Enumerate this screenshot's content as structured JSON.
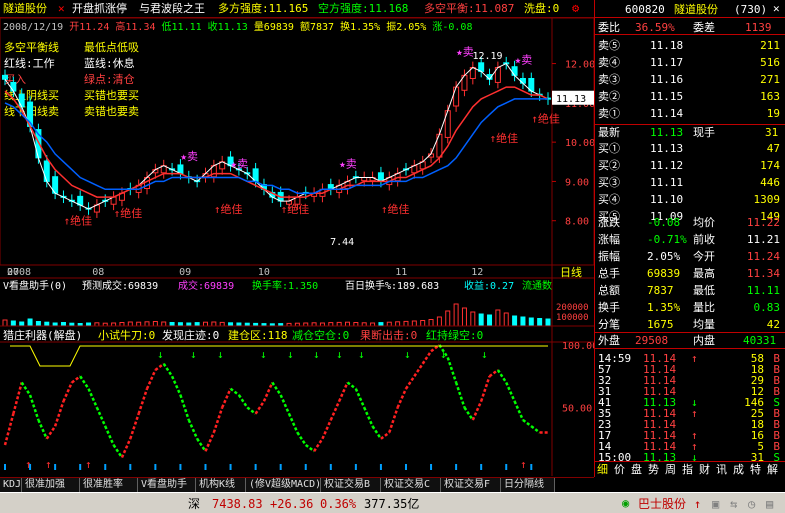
{
  "header": {
    "stock": "隧道股份",
    "items": [
      {
        "label": "开盘抓涨停",
        "color": "#ffffff"
      },
      {
        "label": "与君波段之王",
        "color": "#ffffff"
      },
      {
        "label": "多方强度:11.165",
        "color": "#ffff00"
      },
      {
        "label": "空方强度:11.168",
        "color": "#00ff00"
      },
      {
        "label": "多空平衡:11.087",
        "color": "#ff4040"
      },
      {
        "label": "洗盘:0",
        "color": "#ffff00"
      }
    ]
  },
  "ohlc_bar": {
    "date": "2008/12/19",
    "open": "开11.24",
    "high": "高11.34",
    "low": "低11.11",
    "close": "收11.13",
    "volume": "量69839",
    "amount": "额7837",
    "turnover": "换1.35%",
    "amplitude": "振2.05%",
    "change": "涨-0.08"
  },
  "legend": {
    "rows": [
      {
        "a": "多空平衡线",
        "b": "最低点低吸"
      },
      {
        "a": "红线:工作",
        "b": "蓝线:休息"
      },
      {
        "a": "买入",
        "b": "绿点:清仓"
      },
      {
        "a": "线上阴线买",
        "b": "买错也要买"
      },
      {
        "a": "线下阳线卖",
        "b": "卖错也要卖"
      }
    ]
  },
  "chart_annotations": {
    "sell_label": "卖",
    "buy_label": "绝佳",
    "high_price": "12.19",
    "low_price": "7.44",
    "current_price": "11.13",
    "timeframe": "日线"
  },
  "chart_data": [
    {
      "type": "line",
      "title": "",
      "x_axis_labels": [
        "2008",
        "07",
        "08",
        "09",
        "10",
        "11",
        "12"
      ],
      "ylim": [
        7,
        12.6
      ],
      "y_ticks": [
        12.0,
        11.0,
        10.0,
        9.0,
        8.0
      ],
      "series": [
        {
          "values": [
            11.6,
            11.3,
            10.9,
            10.4,
            9.6,
            9.0,
            8.7,
            8.6,
            8.5,
            8.4,
            8.3,
            8.4,
            8.5,
            8.6,
            8.7,
            8.8,
            8.9,
            9.1,
            9.3,
            9.4,
            9.3,
            9.2,
            9.1,
            9.0,
            9.2,
            9.4,
            9.5,
            9.4,
            9.3,
            9.2,
            9.0,
            8.8,
            8.6,
            8.5,
            8.5,
            8.6,
            8.7,
            8.7,
            8.8,
            8.8,
            8.9,
            9.0,
            9.1,
            9.1,
            9.1,
            9.0,
            9.1,
            9.2,
            9.3,
            9.4,
            9.5,
            9.7,
            10.2,
            10.8,
            11.4,
            11.7,
            11.9,
            11.8,
            11.6,
            11.9,
            12.0,
            11.7,
            11.5,
            11.3,
            11.2,
            11.1
          ]
        },
        {
          "values": [
            11.3,
            11.1,
            10.8,
            10.4,
            10.0,
            9.6,
            9.3,
            9.1,
            8.9,
            8.8,
            8.7,
            8.6,
            8.6,
            8.6,
            8.7,
            8.8,
            8.9,
            9.0,
            9.1,
            9.2,
            9.2,
            9.2,
            9.1,
            9.1,
            9.1,
            9.2,
            9.2,
            9.2,
            9.1,
            9.0,
            8.9,
            8.8,
            8.7,
            8.6,
            8.6,
            8.6,
            8.6,
            8.7,
            8.7,
            8.8,
            8.8,
            8.9,
            8.9,
            9.0,
            9.0,
            9.0,
            9.0,
            9.1,
            9.1,
            9.2,
            9.3,
            9.4,
            9.6,
            9.9,
            10.3,
            10.6,
            10.9,
            11.1,
            11.2,
            11.3,
            11.4,
            11.4,
            11.3,
            11.2,
            11.2,
            11.1
          ]
        },
        {
          "values": [
            11.0,
            10.9,
            10.7,
            10.5,
            10.2,
            10.0,
            9.7,
            9.5,
            9.3,
            9.1,
            9.0,
            8.9,
            8.8,
            8.8,
            8.8,
            8.8,
            8.8,
            8.9,
            9.0,
            9.0,
            9.1,
            9.1,
            9.1,
            9.1,
            9.1,
            9.1,
            9.1,
            9.1,
            9.1,
            9.0,
            9.0,
            8.9,
            8.9,
            8.8,
            8.8,
            8.7,
            8.7,
            8.7,
            8.8,
            8.8,
            8.8,
            8.8,
            8.9,
            8.9,
            8.9,
            8.9,
            9.0,
            9.0,
            9.0,
            9.1,
            9.1,
            9.2,
            9.3,
            9.4,
            9.6,
            9.9,
            10.2,
            10.5,
            10.7,
            10.9,
            11.0,
            11.1,
            11.1,
            11.1,
            11.1,
            11.1
          ]
        }
      ]
    },
    {
      "type": "bar",
      "title": "V看盘助手(0)",
      "text": "预测成交:69839",
      "ylim": [
        0,
        300000
      ],
      "y_ticks": [
        200000,
        100000
      ],
      "series": [
        {
          "name": "成交",
          "values": [
            60000,
            50000,
            40000,
            70000,
            45000,
            38000,
            30000,
            35000,
            28000,
            25000,
            30000,
            32000,
            28000,
            30000,
            35000,
            40000,
            38000,
            42000,
            45000,
            40000,
            35000,
            33000,
            30000,
            34000,
            38000,
            40000,
            36000,
            32000,
            30000,
            28000,
            26000,
            24000,
            22000,
            24000,
            26000,
            28000,
            30000,
            32000,
            30000,
            34000,
            36000,
            38000,
            35000,
            32000,
            30000,
            34000,
            38000,
            42000,
            46000,
            50000,
            55000,
            65000,
            90000,
            150000,
            220000,
            180000,
            140000,
            120000,
            110000,
            160000,
            130000,
            100000,
            90000,
            80000,
            75000,
            69839
          ]
        }
      ],
      "labels": [
        "成交:69839",
        "换手率:1.350",
        "百日换手%:189.683",
        "收益:0.27",
        "流通数"
      ]
    },
    {
      "type": "line",
      "title": "猎庄利器(解盘)",
      "ylim": [
        0,
        100
      ],
      "y_ticks": [
        50,
        100
      ],
      "labels": [
        "小试牛刀:0",
        "发现庄迹:0",
        "建仓区:118",
        "减仓空仓:0",
        "果断出击:0",
        "红持绿空:0"
      ],
      "series": [
        {
          "values": [
            20,
            45,
            70,
            60,
            40,
            25,
            35,
            55,
            70,
            75,
            65,
            50,
            35,
            20,
            10,
            25,
            45,
            65,
            80,
            85,
            75,
            60,
            40,
            25,
            15,
            30,
            50,
            65,
            60,
            50,
            45,
            55,
            70,
            60,
            45,
            30,
            20,
            15,
            25,
            40,
            55,
            70,
            65,
            50,
            35,
            25,
            30,
            50,
            65,
            75,
            85,
            95,
            100,
            90,
            70,
            50,
            40,
            55,
            75,
            80,
            70,
            55,
            40,
            35,
            30,
            30
          ]
        }
      ]
    }
  ],
  "right_panel": {
    "code": "600820",
    "name": "隧道股份",
    "num": "(730)",
    "weibi_label": "委比",
    "weibi_val": "36.59%",
    "weicha_label": "委差",
    "weicha_val": "1139",
    "asks": [
      {
        "label": "卖⑤",
        "price": "11.18",
        "vol": "211"
      },
      {
        "label": "卖④",
        "price": "11.17",
        "vol": "516"
      },
      {
        "label": "卖③",
        "price": "11.16",
        "vol": "271"
      },
      {
        "label": "卖②",
        "price": "11.15",
        "vol": "163"
      },
      {
        "label": "卖①",
        "price": "11.14",
        "vol": "19"
      }
    ],
    "latest_label": "最新",
    "latest_val": "11.13",
    "now_hand_label": "现手",
    "now_hand_val": "31",
    "bids": [
      {
        "label": "买①",
        "price": "11.13",
        "vol": "47"
      },
      {
        "label": "买②",
        "price": "11.12",
        "vol": "174"
      },
      {
        "label": "买③",
        "price": "11.11",
        "vol": "446"
      },
      {
        "label": "买④",
        "price": "11.10",
        "vol": "1309"
      },
      {
        "label": "买⑤",
        "price": "11.09",
        "vol": "149"
      }
    ],
    "stats": [
      {
        "l1": "涨跌",
        "v1": "-0.08",
        "c1": "#00ff00",
        "l2": "均价",
        "v2": "11.22",
        "c2": "#ff4040"
      },
      {
        "l1": "涨幅",
        "v1": "-0.71%",
        "c1": "#00ff00",
        "l2": "前收",
        "v2": "11.21",
        "c2": "#ffffff"
      },
      {
        "l1": "振幅",
        "v1": "2.05%",
        "c1": "#ffffff",
        "l2": "今开",
        "v2": "11.24",
        "c2": "#ff4040"
      },
      {
        "l1": "总手",
        "v1": "69839",
        "c1": "#ffff00",
        "l2": "最高",
        "v2": "11.34",
        "c2": "#ff4040"
      },
      {
        "l1": "总额",
        "v1": "7837",
        "c1": "#ffff00",
        "l2": "最低",
        "v2": "11.11",
        "c2": "#00ff00"
      },
      {
        "l1": "换手",
        "v1": "1.35%",
        "c1": "#ffff00",
        "l2": "量比",
        "v2": "0.83",
        "c2": "#00ff00"
      },
      {
        "l1": "分笔",
        "v1": "1675",
        "c1": "#ffff00",
        "l2": "均量",
        "v2": "42",
        "c2": "#ffff00"
      }
    ],
    "outer_label": "外盘",
    "outer_val": "29508",
    "inner_label": "内盘",
    "inner_val": "40331",
    "ticks": [
      {
        "time": "14:59",
        "price": "11.14",
        "arrow": "↑",
        "vol": "58",
        "side": "B",
        "color": "#ff4040"
      },
      {
        "time": "57",
        "price": "11.14",
        "arrow": "",
        "vol": "18",
        "side": "B",
        "color": "#ff4040"
      },
      {
        "time": "32",
        "price": "11.14",
        "arrow": "",
        "vol": "29",
        "side": "B",
        "color": "#ff4040"
      },
      {
        "time": "31",
        "price": "11.14",
        "arrow": "",
        "vol": "12",
        "side": "B",
        "color": "#ff4040"
      },
      {
        "time": "41",
        "price": "11.13",
        "arrow": "↓",
        "vol": "146",
        "side": "S",
        "color": "#00ff00"
      },
      {
        "time": "35",
        "price": "11.14",
        "arrow": "↑",
        "vol": "25",
        "side": "B",
        "color": "#ff4040"
      },
      {
        "time": "23",
        "price": "11.14",
        "arrow": "",
        "vol": "18",
        "side": "B",
        "color": "#ff4040"
      },
      {
        "time": "17",
        "price": "11.14",
        "arrow": "↑",
        "vol": "16",
        "side": "B",
        "color": "#ff4040"
      },
      {
        "time": "14",
        "price": "11.14",
        "arrow": "↑",
        "vol": "5",
        "side": "B",
        "color": "#ff4040"
      },
      {
        "time": "15:00",
        "price": "11.13",
        "arrow": "↓",
        "vol": "31",
        "side": "S",
        "color": "#00ff00"
      }
    ],
    "bottom_tabs": [
      "细",
      "价",
      "盘",
      "势",
      "周",
      "指",
      "财",
      "讯",
      "成",
      "特",
      "解"
    ]
  },
  "tabs": [
    "KDJ",
    "很准加强",
    "很准胜率",
    "V看盘助手",
    "机构K线",
    "(修V超级MACD)",
    "权证交易B",
    "权证交易C",
    "权证交易F",
    "日分隔线"
  ],
  "status": {
    "market": "深",
    "index": "7438.83",
    "change": "+26.36",
    "percent": "0.36%",
    "amount": "377.35亿",
    "ticker_name": "巴士股份",
    "ticker_arrow": "↑"
  }
}
